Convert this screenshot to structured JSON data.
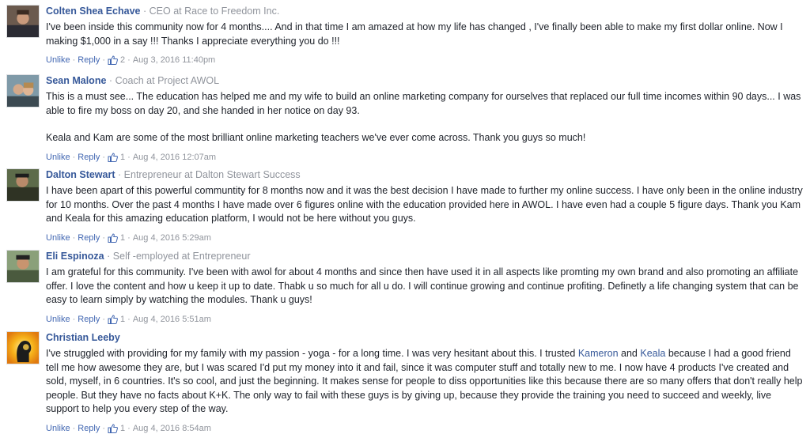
{
  "comments": [
    {
      "author": "Colten Shea Echave",
      "title": "CEO at Race to Freedom Inc.",
      "paragraphs": [
        "I've been inside this community now for 4 months.... And in that time I am amazed at how my life has changed , I've finally been able to make my first dollar online. Now I making $1,000 in a say !!! Thanks I appreciate everything you do !!!"
      ],
      "unlike": "Unlike",
      "reply": "Reply",
      "likes": "2",
      "date": "Aug 3, 2016 11:40pm"
    },
    {
      "author": "Sean Malone",
      "title": "Coach at Project AWOL",
      "paragraphs": [
        "This is a must see... The education has helped me and my wife to build an online marketing company for ourselves that replaced our full time incomes within 90 days... I was able to fire my boss on day 20, and she handed in her notice on day 93.",
        "Keala and Kam are some of the most brilliant online marketing teachers we've ever come across. Thank you guys so much!"
      ],
      "unlike": "Unlike",
      "reply": "Reply",
      "likes": "1",
      "date": "Aug 4, 2016 12:07am"
    },
    {
      "author": "Dalton Stewart",
      "title": "Entrepreneur at Dalton Stewart Success",
      "paragraphs": [
        "I have been apart of this powerful communtity for 8 months now and it was the best decision I have made to further my online success. I have only been in the online industry for 10 months. Over the past 4 months I have made over 6 figures online with the education provided here in AWOL. I have even had a couple 5 figure days. Thank you Kam and Keala for this amazing education platform, I would not be here without you guys."
      ],
      "unlike": "Unlike",
      "reply": "Reply",
      "likes": "1",
      "date": "Aug 4, 2016 5:29am"
    },
    {
      "author": "Eli Espinoza",
      "title": "Self -employed at Entrepreneur",
      "paragraphs": [
        "I am grateful for this community. I've been with awol for about 4 months and since then have used it in all aspects like promting my own brand and also promoting an affiliate offer. I love the content and how u keep it up to date. Thabk u so much for all u do. I will continue growing and continue profiting. Definetly a life changing system that can be easy to learn simply by watching the modules. Thank u guys!"
      ],
      "unlike": "Unlike",
      "reply": "Reply",
      "likes": "1",
      "date": "Aug 4, 2016 5:51am"
    },
    {
      "author": "Christian Leeby",
      "title": "",
      "text_before": "I've struggled with providing for my family with my passion - yoga - for a long time. I was very hesitant about this. I trusted ",
      "mention1": "Kameron",
      "text_mid": " and ",
      "mention2": "Keala",
      "text_after": " because I had a good friend tell me how awesome they are, but I was scared I'd put my money into it and fail, since it was computer stuff and totally new to me. I now have 4 products I've created and sold, myself, in 6 countries. It's so cool, and just the beginning. It makes sense for people to diss opportunities like this because there are so many offers that don't really help people. But they have no facts about K+K. The only way to fail with these guys is by giving up, because they provide the training you need to succeed and weekly, live support to help you every step of the way.",
      "unlike": "Unlike",
      "reply": "Reply",
      "likes": "1",
      "date": "Aug 4, 2016 8:54am"
    }
  ],
  "separator": "·",
  "colors": {
    "link": "#365899",
    "action": "#4267b2",
    "meta": "#90949c",
    "text": "#1d2129"
  },
  "icons": {
    "like": "thumbs-up-icon"
  }
}
